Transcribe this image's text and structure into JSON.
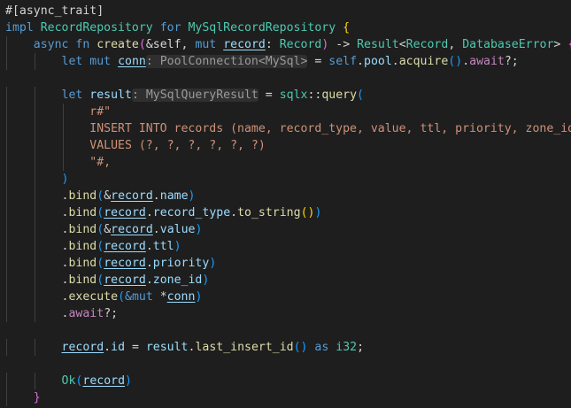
{
  "editor": {
    "language": "rust",
    "theme": {
      "background": "#1e1e1e",
      "default": "#d4d4d4",
      "keyword": "#569cd6",
      "control": "#c586c0",
      "type": "#4ec9b0",
      "function": "#dcdcaa",
      "variable": "#9cdcfe",
      "string": "#ce9178",
      "bracket1": "#ffd700",
      "bracket2": "#da70d6",
      "bracket3": "#179fff",
      "inlay_hint": "#9a9a9a",
      "indent_guide": "#404040"
    },
    "lines": [
      [
        {
          "t": "#[async_trait]",
          "c": "default"
        }
      ],
      [
        {
          "t": "impl ",
          "c": "keyword"
        },
        {
          "t": "RecordRepository",
          "c": "type"
        },
        {
          "t": " for ",
          "c": "keyword"
        },
        {
          "t": "MySqlRecordRepository",
          "c": "type"
        },
        {
          "t": " ",
          "c": "default"
        },
        {
          "t": "{",
          "c": "bracket1"
        }
      ],
      [
        {
          "t": "    ",
          "c": "default"
        },
        {
          "t": "async fn ",
          "c": "keyword"
        },
        {
          "t": "create",
          "c": "function"
        },
        {
          "t": "(",
          "c": "bracket2"
        },
        {
          "t": "&self",
          "c": "default"
        },
        {
          "t": ", ",
          "c": "default"
        },
        {
          "t": "mut ",
          "c": "keyword"
        },
        {
          "t": "record",
          "c": "variable",
          "u": true
        },
        {
          "t": ": ",
          "c": "default"
        },
        {
          "t": "Record",
          "c": "type"
        },
        {
          "t": ")",
          "c": "bracket2"
        },
        {
          "t": " -> ",
          "c": "default"
        },
        {
          "t": "Result",
          "c": "type"
        },
        {
          "t": "<",
          "c": "default"
        },
        {
          "t": "Record",
          "c": "type"
        },
        {
          "t": ", ",
          "c": "default"
        },
        {
          "t": "DatabaseError",
          "c": "type"
        },
        {
          "t": "> ",
          "c": "default"
        },
        {
          "t": "{",
          "c": "bracket2"
        }
      ],
      [
        {
          "t": "        ",
          "c": "default"
        },
        {
          "t": "let mut ",
          "c": "keyword"
        },
        {
          "t": "conn",
          "c": "variable",
          "u": true
        },
        {
          "t": ": PoolConnection<MySql>",
          "c": "inlay"
        },
        {
          "t": " = ",
          "c": "default"
        },
        {
          "t": "self",
          "c": "keyword"
        },
        {
          "t": ".",
          "c": "default"
        },
        {
          "t": "pool",
          "c": "variable"
        },
        {
          "t": ".",
          "c": "default"
        },
        {
          "t": "acquire",
          "c": "function"
        },
        {
          "t": "()",
          "c": "bracket3"
        },
        {
          "t": ".",
          "c": "default"
        },
        {
          "t": "await",
          "c": "control"
        },
        {
          "t": "?;",
          "c": "default"
        }
      ],
      [],
      [
        {
          "t": "        ",
          "c": "default"
        },
        {
          "t": "let ",
          "c": "keyword"
        },
        {
          "t": "result",
          "c": "variable"
        },
        {
          "t": ": MySqlQueryResult",
          "c": "inlay"
        },
        {
          "t": " = ",
          "c": "default"
        },
        {
          "t": "sqlx",
          "c": "type"
        },
        {
          "t": "::",
          "c": "default"
        },
        {
          "t": "query",
          "c": "function"
        },
        {
          "t": "(",
          "c": "bracket3"
        }
      ],
      [
        {
          "t": "            ",
          "c": "default"
        },
        {
          "t": "r#\"",
          "c": "string"
        }
      ],
      [
        {
          "t": "            ",
          "c": "default"
        },
        {
          "t": "INSERT INTO records (name, record_type, value, ttl, priority, zone_id)",
          "c": "string"
        }
      ],
      [
        {
          "t": "            ",
          "c": "default"
        },
        {
          "t": "VALUES (?, ?, ?, ?, ?, ?)",
          "c": "string"
        }
      ],
      [
        {
          "t": "            ",
          "c": "default"
        },
        {
          "t": "\"#,",
          "c": "string"
        }
      ],
      [
        {
          "t": "        ",
          "c": "default"
        },
        {
          "t": ")",
          "c": "bracket3"
        }
      ],
      [
        {
          "t": "        ",
          "c": "default"
        },
        {
          "t": ".",
          "c": "default"
        },
        {
          "t": "bind",
          "c": "function"
        },
        {
          "t": "(",
          "c": "bracket3"
        },
        {
          "t": "&",
          "c": "default"
        },
        {
          "t": "record",
          "c": "variable",
          "u": true
        },
        {
          "t": ".",
          "c": "default"
        },
        {
          "t": "name",
          "c": "variable"
        },
        {
          "t": ")",
          "c": "bracket3"
        }
      ],
      [
        {
          "t": "        ",
          "c": "default"
        },
        {
          "t": ".",
          "c": "default"
        },
        {
          "t": "bind",
          "c": "function"
        },
        {
          "t": "(",
          "c": "bracket3"
        },
        {
          "t": "record",
          "c": "variable",
          "u": true
        },
        {
          "t": ".",
          "c": "default"
        },
        {
          "t": "record_type",
          "c": "variable"
        },
        {
          "t": ".",
          "c": "default"
        },
        {
          "t": "to_string",
          "c": "function"
        },
        {
          "t": "()",
          "c": "bracket1"
        },
        {
          "t": ")",
          "c": "bracket3"
        }
      ],
      [
        {
          "t": "        ",
          "c": "default"
        },
        {
          "t": ".",
          "c": "default"
        },
        {
          "t": "bind",
          "c": "function"
        },
        {
          "t": "(",
          "c": "bracket3"
        },
        {
          "t": "&",
          "c": "default"
        },
        {
          "t": "record",
          "c": "variable",
          "u": true
        },
        {
          "t": ".",
          "c": "default"
        },
        {
          "t": "value",
          "c": "variable"
        },
        {
          "t": ")",
          "c": "bracket3"
        }
      ],
      [
        {
          "t": "        ",
          "c": "default"
        },
        {
          "t": ".",
          "c": "default"
        },
        {
          "t": "bind",
          "c": "function"
        },
        {
          "t": "(",
          "c": "bracket3"
        },
        {
          "t": "record",
          "c": "variable",
          "u": true
        },
        {
          "t": ".",
          "c": "default"
        },
        {
          "t": "ttl",
          "c": "variable"
        },
        {
          "t": ")",
          "c": "bracket3"
        }
      ],
      [
        {
          "t": "        ",
          "c": "default"
        },
        {
          "t": ".",
          "c": "default"
        },
        {
          "t": "bind",
          "c": "function"
        },
        {
          "t": "(",
          "c": "bracket3"
        },
        {
          "t": "record",
          "c": "variable",
          "u": true
        },
        {
          "t": ".",
          "c": "default"
        },
        {
          "t": "priority",
          "c": "variable"
        },
        {
          "t": ")",
          "c": "bracket3"
        }
      ],
      [
        {
          "t": "        ",
          "c": "default"
        },
        {
          "t": ".",
          "c": "default"
        },
        {
          "t": "bind",
          "c": "function"
        },
        {
          "t": "(",
          "c": "bracket3"
        },
        {
          "t": "record",
          "c": "variable",
          "u": true
        },
        {
          "t": ".",
          "c": "default"
        },
        {
          "t": "zone_id",
          "c": "variable"
        },
        {
          "t": ")",
          "c": "bracket3"
        }
      ],
      [
        {
          "t": "        ",
          "c": "default"
        },
        {
          "t": ".",
          "c": "default"
        },
        {
          "t": "execute",
          "c": "function"
        },
        {
          "t": "(",
          "c": "bracket3"
        },
        {
          "t": "&mut ",
          "c": "keyword"
        },
        {
          "t": "*",
          "c": "default"
        },
        {
          "t": "conn",
          "c": "variable",
          "u": true
        },
        {
          "t": ")",
          "c": "bracket3"
        }
      ],
      [
        {
          "t": "        ",
          "c": "default"
        },
        {
          "t": ".",
          "c": "default"
        },
        {
          "t": "await",
          "c": "control"
        },
        {
          "t": "?;",
          "c": "default"
        }
      ],
      [],
      [
        {
          "t": "        ",
          "c": "default"
        },
        {
          "t": "record",
          "c": "variable",
          "u": true
        },
        {
          "t": ".",
          "c": "default"
        },
        {
          "t": "id",
          "c": "variable"
        },
        {
          "t": " = ",
          "c": "default"
        },
        {
          "t": "result",
          "c": "variable"
        },
        {
          "t": ".",
          "c": "default"
        },
        {
          "t": "last_insert_id",
          "c": "function"
        },
        {
          "t": "()",
          "c": "bracket3"
        },
        {
          "t": " as ",
          "c": "keyword"
        },
        {
          "t": "i32",
          "c": "type"
        },
        {
          "t": ";",
          "c": "default"
        }
      ],
      [],
      [
        {
          "t": "        ",
          "c": "default"
        },
        {
          "t": "Ok",
          "c": "type"
        },
        {
          "t": "(",
          "c": "bracket3"
        },
        {
          "t": "record",
          "c": "variable",
          "u": true
        },
        {
          "t": ")",
          "c": "bracket3"
        }
      ],
      [
        {
          "t": "    ",
          "c": "default"
        },
        {
          "t": "}",
          "c": "bracket2"
        }
      ]
    ]
  }
}
